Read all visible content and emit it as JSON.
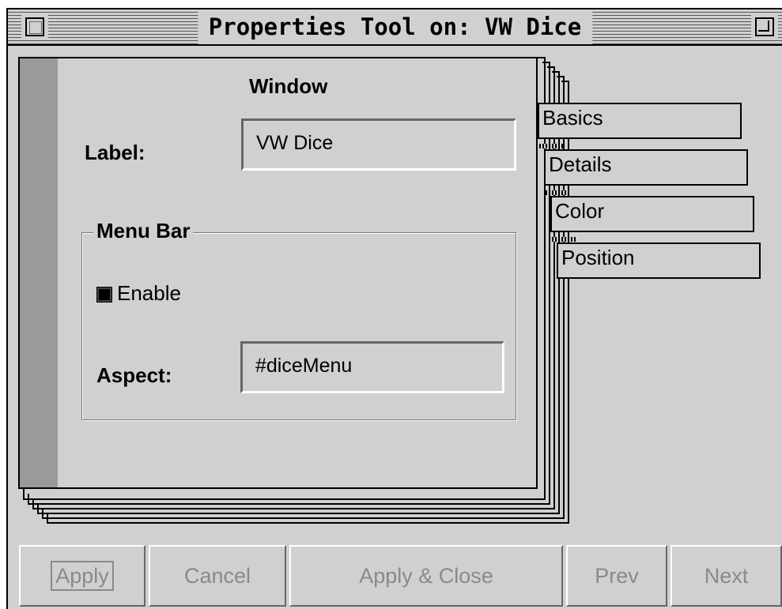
{
  "window": {
    "title": "Properties Tool on: VW Dice"
  },
  "page": {
    "title": "Window",
    "label_caption": "Label:",
    "label_value": "VW Dice",
    "menu_bar": {
      "title": "Menu Bar",
      "enable_label": "Enable",
      "enable_checked": true,
      "aspect_caption": "Aspect:",
      "aspect_value": "#diceMenu"
    }
  },
  "tabs": [
    {
      "label": "Basics"
    },
    {
      "label": "Details"
    },
    {
      "label": "Color"
    },
    {
      "label": "Position"
    }
  ],
  "buttons": {
    "apply": "Apply",
    "cancel": "Cancel",
    "apply_close": "Apply & Close",
    "prev": "Prev",
    "next": "Next"
  }
}
